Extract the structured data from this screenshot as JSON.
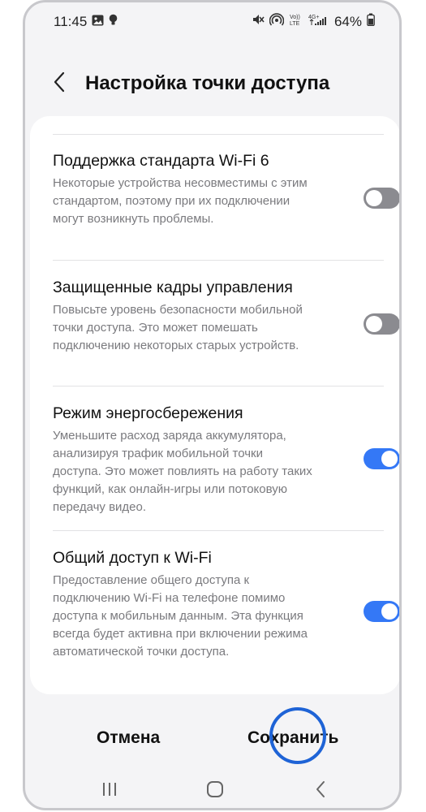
{
  "status_bar": {
    "time": "11:45",
    "battery_percent": "64%",
    "left_icons": [
      "image-icon",
      "bulb-icon"
    ],
    "right_icons": [
      "mute-icon",
      "hotspot-icon",
      "volte-icon",
      "signal-4g-icon",
      "battery-icon"
    ]
  },
  "header": {
    "back_icon": "chevron-left-icon",
    "title": "Настройка точки доступа"
  },
  "settings": [
    {
      "title": "Поддержка стандарта Wi-Fi 6",
      "description": "Некоторые устройства несовместимы с этим стандартом, поэтому при их подключении могут возникнуть проблемы.",
      "enabled": false
    },
    {
      "title": "Защищенные кадры управления",
      "description": "Повысьте уровень безопасности мобильной точки доступа. Это может помешать подключению некоторых старых устройств.",
      "enabled": false
    },
    {
      "title": "Режим энергосбережения",
      "description": "Уменьшите расход заряда аккумулятора, анализируя трафик мобильной точки доступа. Это может повлиять на работу таких функций, как онлайн-игры или потоковую передачу видео.",
      "enabled": true
    },
    {
      "title": "Общий доступ к Wi-Fi",
      "description": "Предоставление общего доступа к подключению Wi-Fi на телефоне помимо доступа к мобильным данным. Эта функция всегда будет активна при включении режима автоматической точки доступа.",
      "enabled": true
    }
  ],
  "actions": {
    "cancel_label": "Отмена",
    "save_label": "Сохранить"
  },
  "navbar": {
    "icons": [
      "recent-apps-icon",
      "home-icon",
      "back-icon"
    ]
  },
  "colors": {
    "accent": "#3478f6",
    "toggle_off": "#8b8b90",
    "highlight_ring": "#1e63d6"
  }
}
